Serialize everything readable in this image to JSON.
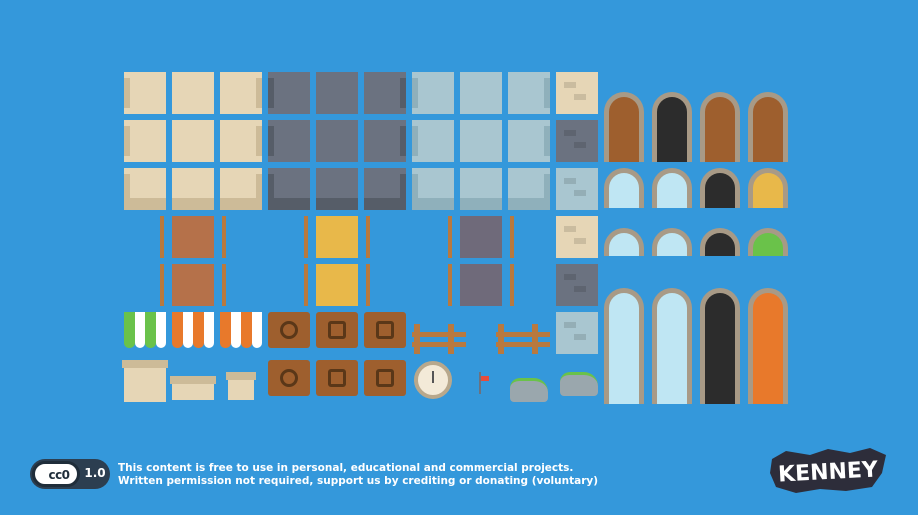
{
  "sheet": {
    "background": "#3498db",
    "palette": {
      "sand": "#e6d6b6",
      "sand_edge": "#cdbb98",
      "slate": "#6b7280",
      "slate_edge": "#565d68",
      "ice": "#a9c6d0",
      "ice_edge": "#8fb0bb",
      "brick": "#b5714a",
      "gold": "#e8b84a",
      "dark_panel": "#6f6a7a",
      "wood": "#9e5f2e",
      "wood_light": "#b8793f",
      "frame": "#a89a86",
      "glass": "#bfe6f3",
      "door_dark": "#2c2c2c",
      "awning_green": "#6ac24a",
      "awning_orange": "#e8792b"
    },
    "tiles": [
      "wall-sand-tile",
      "wall-slate-tile",
      "wall-ice-tile",
      "door-wood-tile",
      "door-dark-tile",
      "window-arched-tile",
      "window-stained-glass-tile",
      "banner-brick-tile",
      "banner-gold-tile",
      "banner-dark-tile",
      "awning-green-tile",
      "awning-orange-tile",
      "sign-coin-tile",
      "sign-mug-tile",
      "sign-bed-tile",
      "fence-tile",
      "clock-tile",
      "weather-vane-tile",
      "rock-tile",
      "chimney-tile"
    ]
  },
  "footer": {
    "cc_label": "cc0",
    "cc_version": "1.0",
    "license_line1": "This content is free to use in personal, educational and commercial projects.",
    "license_line2": "Written permission not required, support us by crediting or donating (voluntary)",
    "brand": "KENNEY"
  }
}
